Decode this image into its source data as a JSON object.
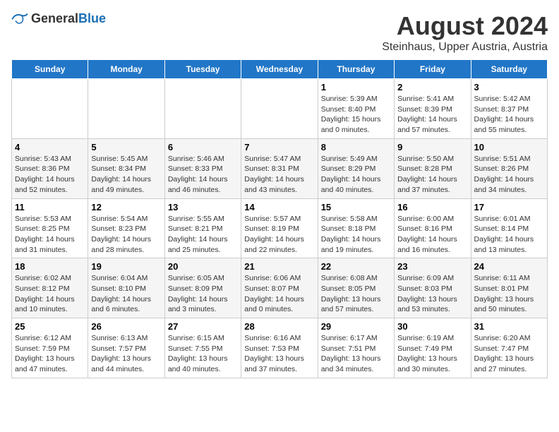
{
  "header": {
    "logo_general": "General",
    "logo_blue": "Blue",
    "main_title": "August 2024",
    "subtitle": "Steinhaus, Upper Austria, Austria"
  },
  "days_of_week": [
    "Sunday",
    "Monday",
    "Tuesday",
    "Wednesday",
    "Thursday",
    "Friday",
    "Saturday"
  ],
  "weeks": [
    [
      {
        "day": "",
        "detail": ""
      },
      {
        "day": "",
        "detail": ""
      },
      {
        "day": "",
        "detail": ""
      },
      {
        "day": "",
        "detail": ""
      },
      {
        "day": "1",
        "detail": "Sunrise: 5:39 AM\nSunset: 8:40 PM\nDaylight: 15 hours and 0 minutes."
      },
      {
        "day": "2",
        "detail": "Sunrise: 5:41 AM\nSunset: 8:39 PM\nDaylight: 14 hours and 57 minutes."
      },
      {
        "day": "3",
        "detail": "Sunrise: 5:42 AM\nSunset: 8:37 PM\nDaylight: 14 hours and 55 minutes."
      }
    ],
    [
      {
        "day": "4",
        "detail": "Sunrise: 5:43 AM\nSunset: 8:36 PM\nDaylight: 14 hours and 52 minutes."
      },
      {
        "day": "5",
        "detail": "Sunrise: 5:45 AM\nSunset: 8:34 PM\nDaylight: 14 hours and 49 minutes."
      },
      {
        "day": "6",
        "detail": "Sunrise: 5:46 AM\nSunset: 8:33 PM\nDaylight: 14 hours and 46 minutes."
      },
      {
        "day": "7",
        "detail": "Sunrise: 5:47 AM\nSunset: 8:31 PM\nDaylight: 14 hours and 43 minutes."
      },
      {
        "day": "8",
        "detail": "Sunrise: 5:49 AM\nSunset: 8:29 PM\nDaylight: 14 hours and 40 minutes."
      },
      {
        "day": "9",
        "detail": "Sunrise: 5:50 AM\nSunset: 8:28 PM\nDaylight: 14 hours and 37 minutes."
      },
      {
        "day": "10",
        "detail": "Sunrise: 5:51 AM\nSunset: 8:26 PM\nDaylight: 14 hours and 34 minutes."
      }
    ],
    [
      {
        "day": "11",
        "detail": "Sunrise: 5:53 AM\nSunset: 8:25 PM\nDaylight: 14 hours and 31 minutes."
      },
      {
        "day": "12",
        "detail": "Sunrise: 5:54 AM\nSunset: 8:23 PM\nDaylight: 14 hours and 28 minutes."
      },
      {
        "day": "13",
        "detail": "Sunrise: 5:55 AM\nSunset: 8:21 PM\nDaylight: 14 hours and 25 minutes."
      },
      {
        "day": "14",
        "detail": "Sunrise: 5:57 AM\nSunset: 8:19 PM\nDaylight: 14 hours and 22 minutes."
      },
      {
        "day": "15",
        "detail": "Sunrise: 5:58 AM\nSunset: 8:18 PM\nDaylight: 14 hours and 19 minutes."
      },
      {
        "day": "16",
        "detail": "Sunrise: 6:00 AM\nSunset: 8:16 PM\nDaylight: 14 hours and 16 minutes."
      },
      {
        "day": "17",
        "detail": "Sunrise: 6:01 AM\nSunset: 8:14 PM\nDaylight: 14 hours and 13 minutes."
      }
    ],
    [
      {
        "day": "18",
        "detail": "Sunrise: 6:02 AM\nSunset: 8:12 PM\nDaylight: 14 hours and 10 minutes."
      },
      {
        "day": "19",
        "detail": "Sunrise: 6:04 AM\nSunset: 8:10 PM\nDaylight: 14 hours and 6 minutes."
      },
      {
        "day": "20",
        "detail": "Sunrise: 6:05 AM\nSunset: 8:09 PM\nDaylight: 14 hours and 3 minutes."
      },
      {
        "day": "21",
        "detail": "Sunrise: 6:06 AM\nSunset: 8:07 PM\nDaylight: 14 hours and 0 minutes."
      },
      {
        "day": "22",
        "detail": "Sunrise: 6:08 AM\nSunset: 8:05 PM\nDaylight: 13 hours and 57 minutes."
      },
      {
        "day": "23",
        "detail": "Sunrise: 6:09 AM\nSunset: 8:03 PM\nDaylight: 13 hours and 53 minutes."
      },
      {
        "day": "24",
        "detail": "Sunrise: 6:11 AM\nSunset: 8:01 PM\nDaylight: 13 hours and 50 minutes."
      }
    ],
    [
      {
        "day": "25",
        "detail": "Sunrise: 6:12 AM\nSunset: 7:59 PM\nDaylight: 13 hours and 47 minutes."
      },
      {
        "day": "26",
        "detail": "Sunrise: 6:13 AM\nSunset: 7:57 PM\nDaylight: 13 hours and 44 minutes."
      },
      {
        "day": "27",
        "detail": "Sunrise: 6:15 AM\nSunset: 7:55 PM\nDaylight: 13 hours and 40 minutes."
      },
      {
        "day": "28",
        "detail": "Sunrise: 6:16 AM\nSunset: 7:53 PM\nDaylight: 13 hours and 37 minutes."
      },
      {
        "day": "29",
        "detail": "Sunrise: 6:17 AM\nSunset: 7:51 PM\nDaylight: 13 hours and 34 minutes."
      },
      {
        "day": "30",
        "detail": "Sunrise: 6:19 AM\nSunset: 7:49 PM\nDaylight: 13 hours and 30 minutes."
      },
      {
        "day": "31",
        "detail": "Sunrise: 6:20 AM\nSunset: 7:47 PM\nDaylight: 13 hours and 27 minutes."
      }
    ]
  ]
}
